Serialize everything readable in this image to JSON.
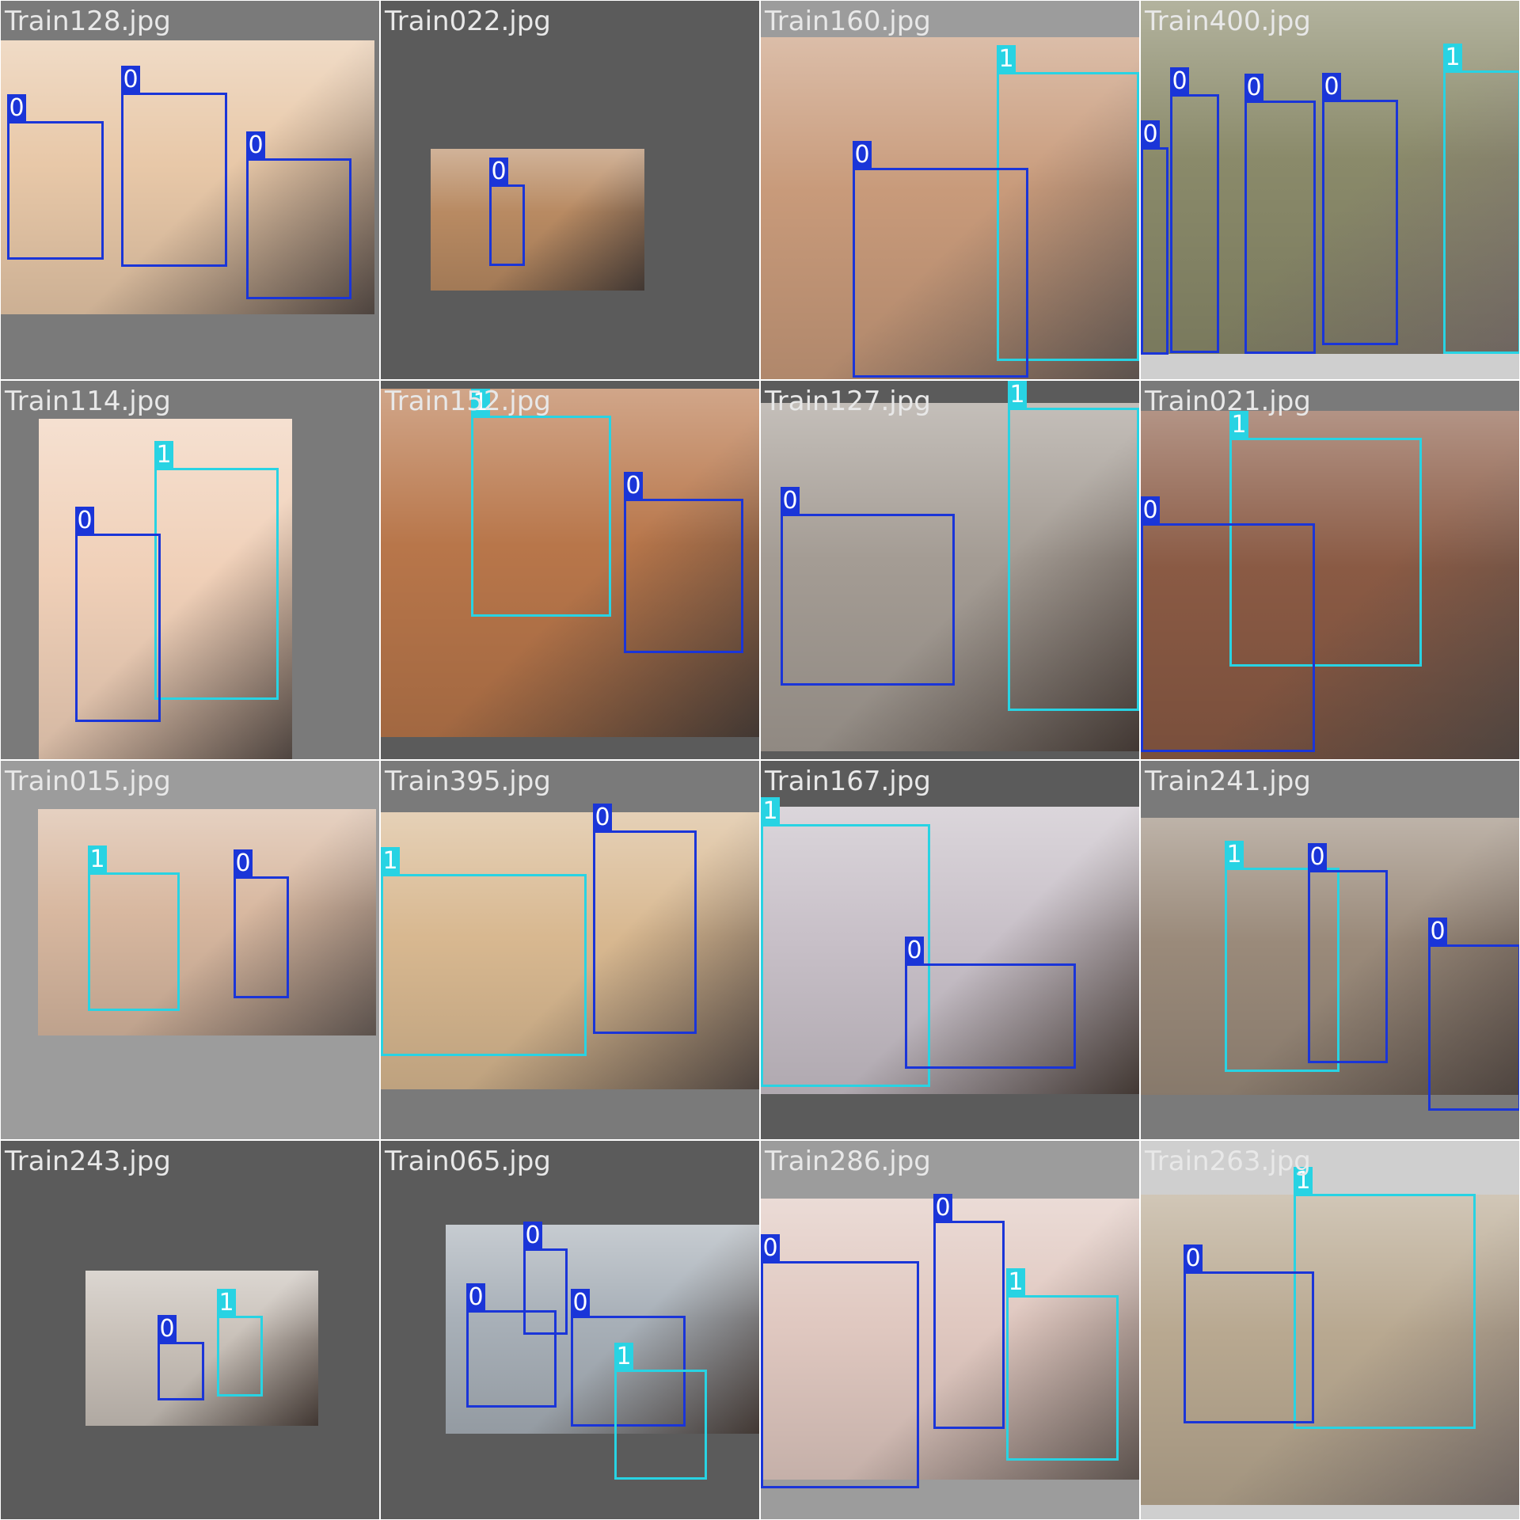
{
  "colors": {
    "class_0": "#1a35d8",
    "class_1": "#28d3e3",
    "label_text": "#ffffff",
    "filename_text": "#e8e8e8"
  },
  "tiles": [
    {
      "filename": "Train128.jpg",
      "bg": "#7a7a7a",
      "photo_tone": "#e8c8a8",
      "boxes": [
        {
          "cls": "0",
          "label": "0"
        },
        {
          "cls": "0",
          "label": "0"
        },
        {
          "cls": "0",
          "label": "0"
        }
      ]
    },
    {
      "filename": "Train022.jpg",
      "bg": "#5b5b5b",
      "photo_tone": "#b88a62",
      "boxes": [
        {
          "cls": "0",
          "label": "0"
        }
      ]
    },
    {
      "filename": "Train160.jpg",
      "bg": "#9c9c9c",
      "photo_tone": "#c89a7a",
      "boxes": [
        {
          "cls": "1",
          "label": "1"
        },
        {
          "cls": "0",
          "label": "0"
        }
      ]
    },
    {
      "filename": "Train400.jpg",
      "bg": "#cfcfcf",
      "photo_tone": "#8a8a6a",
      "boxes": [
        {
          "cls": "0",
          "label": "0"
        },
        {
          "cls": "0",
          "label": "0"
        },
        {
          "cls": "0",
          "label": "0"
        },
        {
          "cls": "0",
          "label": "0"
        },
        {
          "cls": "1",
          "label": "1"
        }
      ]
    },
    {
      "filename": "Train114.jpg",
      "bg": "#7a7a7a",
      "photo_tone": "#f0d0b8",
      "boxes": [
        {
          "cls": "1",
          "label": "1"
        },
        {
          "cls": "0",
          "label": "0"
        }
      ]
    },
    {
      "filename": "Train152.jpg",
      "bg": "#5b5b5b",
      "photo_tone": "#b8764a",
      "boxes": [
        {
          "cls": "1",
          "label": "1"
        },
        {
          "cls": "0",
          "label": "0"
        }
      ]
    },
    {
      "filename": "Train127.jpg",
      "bg": "#5b5b5b",
      "photo_tone": "#a49c94",
      "boxes": [
        {
          "cls": "1",
          "label": "1"
        },
        {
          "cls": "0",
          "label": "0"
        }
      ]
    },
    {
      "filename": "Train021.jpg",
      "bg": "#7a7a7a",
      "photo_tone": "#8a5a44",
      "boxes": [
        {
          "cls": "1",
          "label": "1"
        },
        {
          "cls": "0",
          "label": "0"
        }
      ]
    },
    {
      "filename": "Train015.jpg",
      "bg": "#9c9c9c",
      "photo_tone": "#d8b8a0",
      "boxes": [
        {
          "cls": "1",
          "label": "1"
        },
        {
          "cls": "0",
          "label": "0"
        }
      ]
    },
    {
      "filename": "Train395.jpg",
      "bg": "#7a7a7a",
      "photo_tone": "#d8b890",
      "boxes": [
        {
          "cls": "0",
          "label": "0"
        },
        {
          "cls": "1",
          "label": "1"
        }
      ]
    },
    {
      "filename": "Train167.jpg",
      "bg": "#5b5b5b",
      "photo_tone": "#c8c0c8",
      "boxes": [
        {
          "cls": "1",
          "label": "1"
        },
        {
          "cls": "0",
          "label": "0"
        }
      ]
    },
    {
      "filename": "Train241.jpg",
      "bg": "#7a7a7a",
      "photo_tone": "#9a8a7a",
      "boxes": [
        {
          "cls": "1",
          "label": "1"
        },
        {
          "cls": "0",
          "label": "0"
        },
        {
          "cls": "0",
          "label": "0"
        }
      ]
    },
    {
      "filename": "Train243.jpg",
      "bg": "#5b5b5b",
      "photo_tone": "#c8c0b8",
      "boxes": [
        {
          "cls": "1",
          "label": "1"
        },
        {
          "cls": "0",
          "label": "0"
        }
      ]
    },
    {
      "filename": "Train065.jpg",
      "bg": "#5b5b5b",
      "photo_tone": "#a8b0b8",
      "boxes": [
        {
          "cls": "0",
          "label": "0"
        },
        {
          "cls": "0",
          "label": "0"
        },
        {
          "cls": "0",
          "label": "0"
        },
        {
          "cls": "1",
          "label": "1"
        }
      ]
    },
    {
      "filename": "Train286.jpg",
      "bg": "#9c9c9c",
      "photo_tone": "#e0c8c0",
      "boxes": [
        {
          "cls": "0",
          "label": "0"
        },
        {
          "cls": "0",
          "label": "0"
        },
        {
          "cls": "1",
          "label": "1"
        }
      ]
    },
    {
      "filename": "Train263.jpg",
      "bg": "#cfcfcf",
      "photo_tone": "#b8a890",
      "boxes": [
        {
          "cls": "1",
          "label": "1"
        },
        {
          "cls": "0",
          "label": "0"
        }
      ]
    }
  ]
}
